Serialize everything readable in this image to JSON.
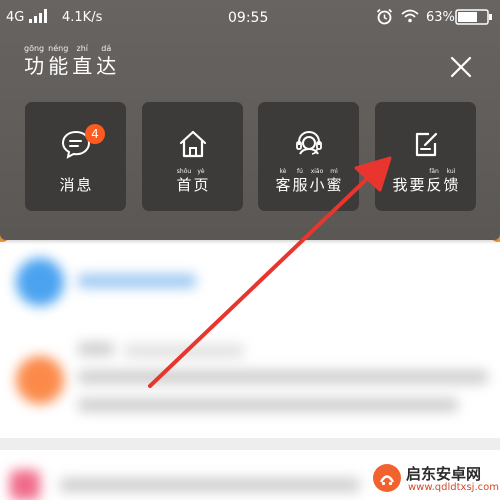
{
  "status_bar": {
    "network": "4G",
    "speed": "4.1K/s",
    "time": "09:55",
    "battery_percent": "63%"
  },
  "panel": {
    "title_chars": [
      {
        "pinyin": "gōng",
        "hanzi": "功"
      },
      {
        "pinyin": "néng",
        "hanzi": "能"
      },
      {
        "pinyin": "zhí",
        "hanzi": "直"
      },
      {
        "pinyin": "dá",
        "hanzi": "达"
      }
    ],
    "close_icon": "close-icon",
    "tiles": [
      {
        "icon": "message-icon",
        "badge": "4",
        "label_chars": [
          {
            "pinyin": "",
            "hanzi": "消"
          },
          {
            "pinyin": "",
            "hanzi": "息"
          }
        ]
      },
      {
        "icon": "home-icon",
        "label_chars": [
          {
            "pinyin": "shǒu",
            "hanzi": "首"
          },
          {
            "pinyin": "yè",
            "hanzi": "页"
          }
        ]
      },
      {
        "icon": "customer-service-icon",
        "label_chars": [
          {
            "pinyin": "kè",
            "hanzi": "客"
          },
          {
            "pinyin": "fú",
            "hanzi": "服"
          },
          {
            "pinyin": "xiǎo",
            "hanzi": "小"
          },
          {
            "pinyin": "mì",
            "hanzi": "蜜"
          }
        ]
      },
      {
        "icon": "feedback-edit-icon",
        "label_chars": [
          {
            "pinyin": "",
            "hanzi": "我"
          },
          {
            "pinyin": "",
            "hanzi": "要"
          },
          {
            "pinyin": "fǎn",
            "hanzi": "反"
          },
          {
            "pinyin": "kuì",
            "hanzi": "馈"
          }
        ]
      }
    ]
  },
  "watermark": {
    "name": "启东安卓网",
    "url": "www.qdldtxsj.com"
  },
  "colors": {
    "overlay": "#5f5c59",
    "tile": "#3d3b3a",
    "badge": "#ff5a1f",
    "arrow": "#e8352e",
    "accent_orange": "#f39a3a"
  }
}
